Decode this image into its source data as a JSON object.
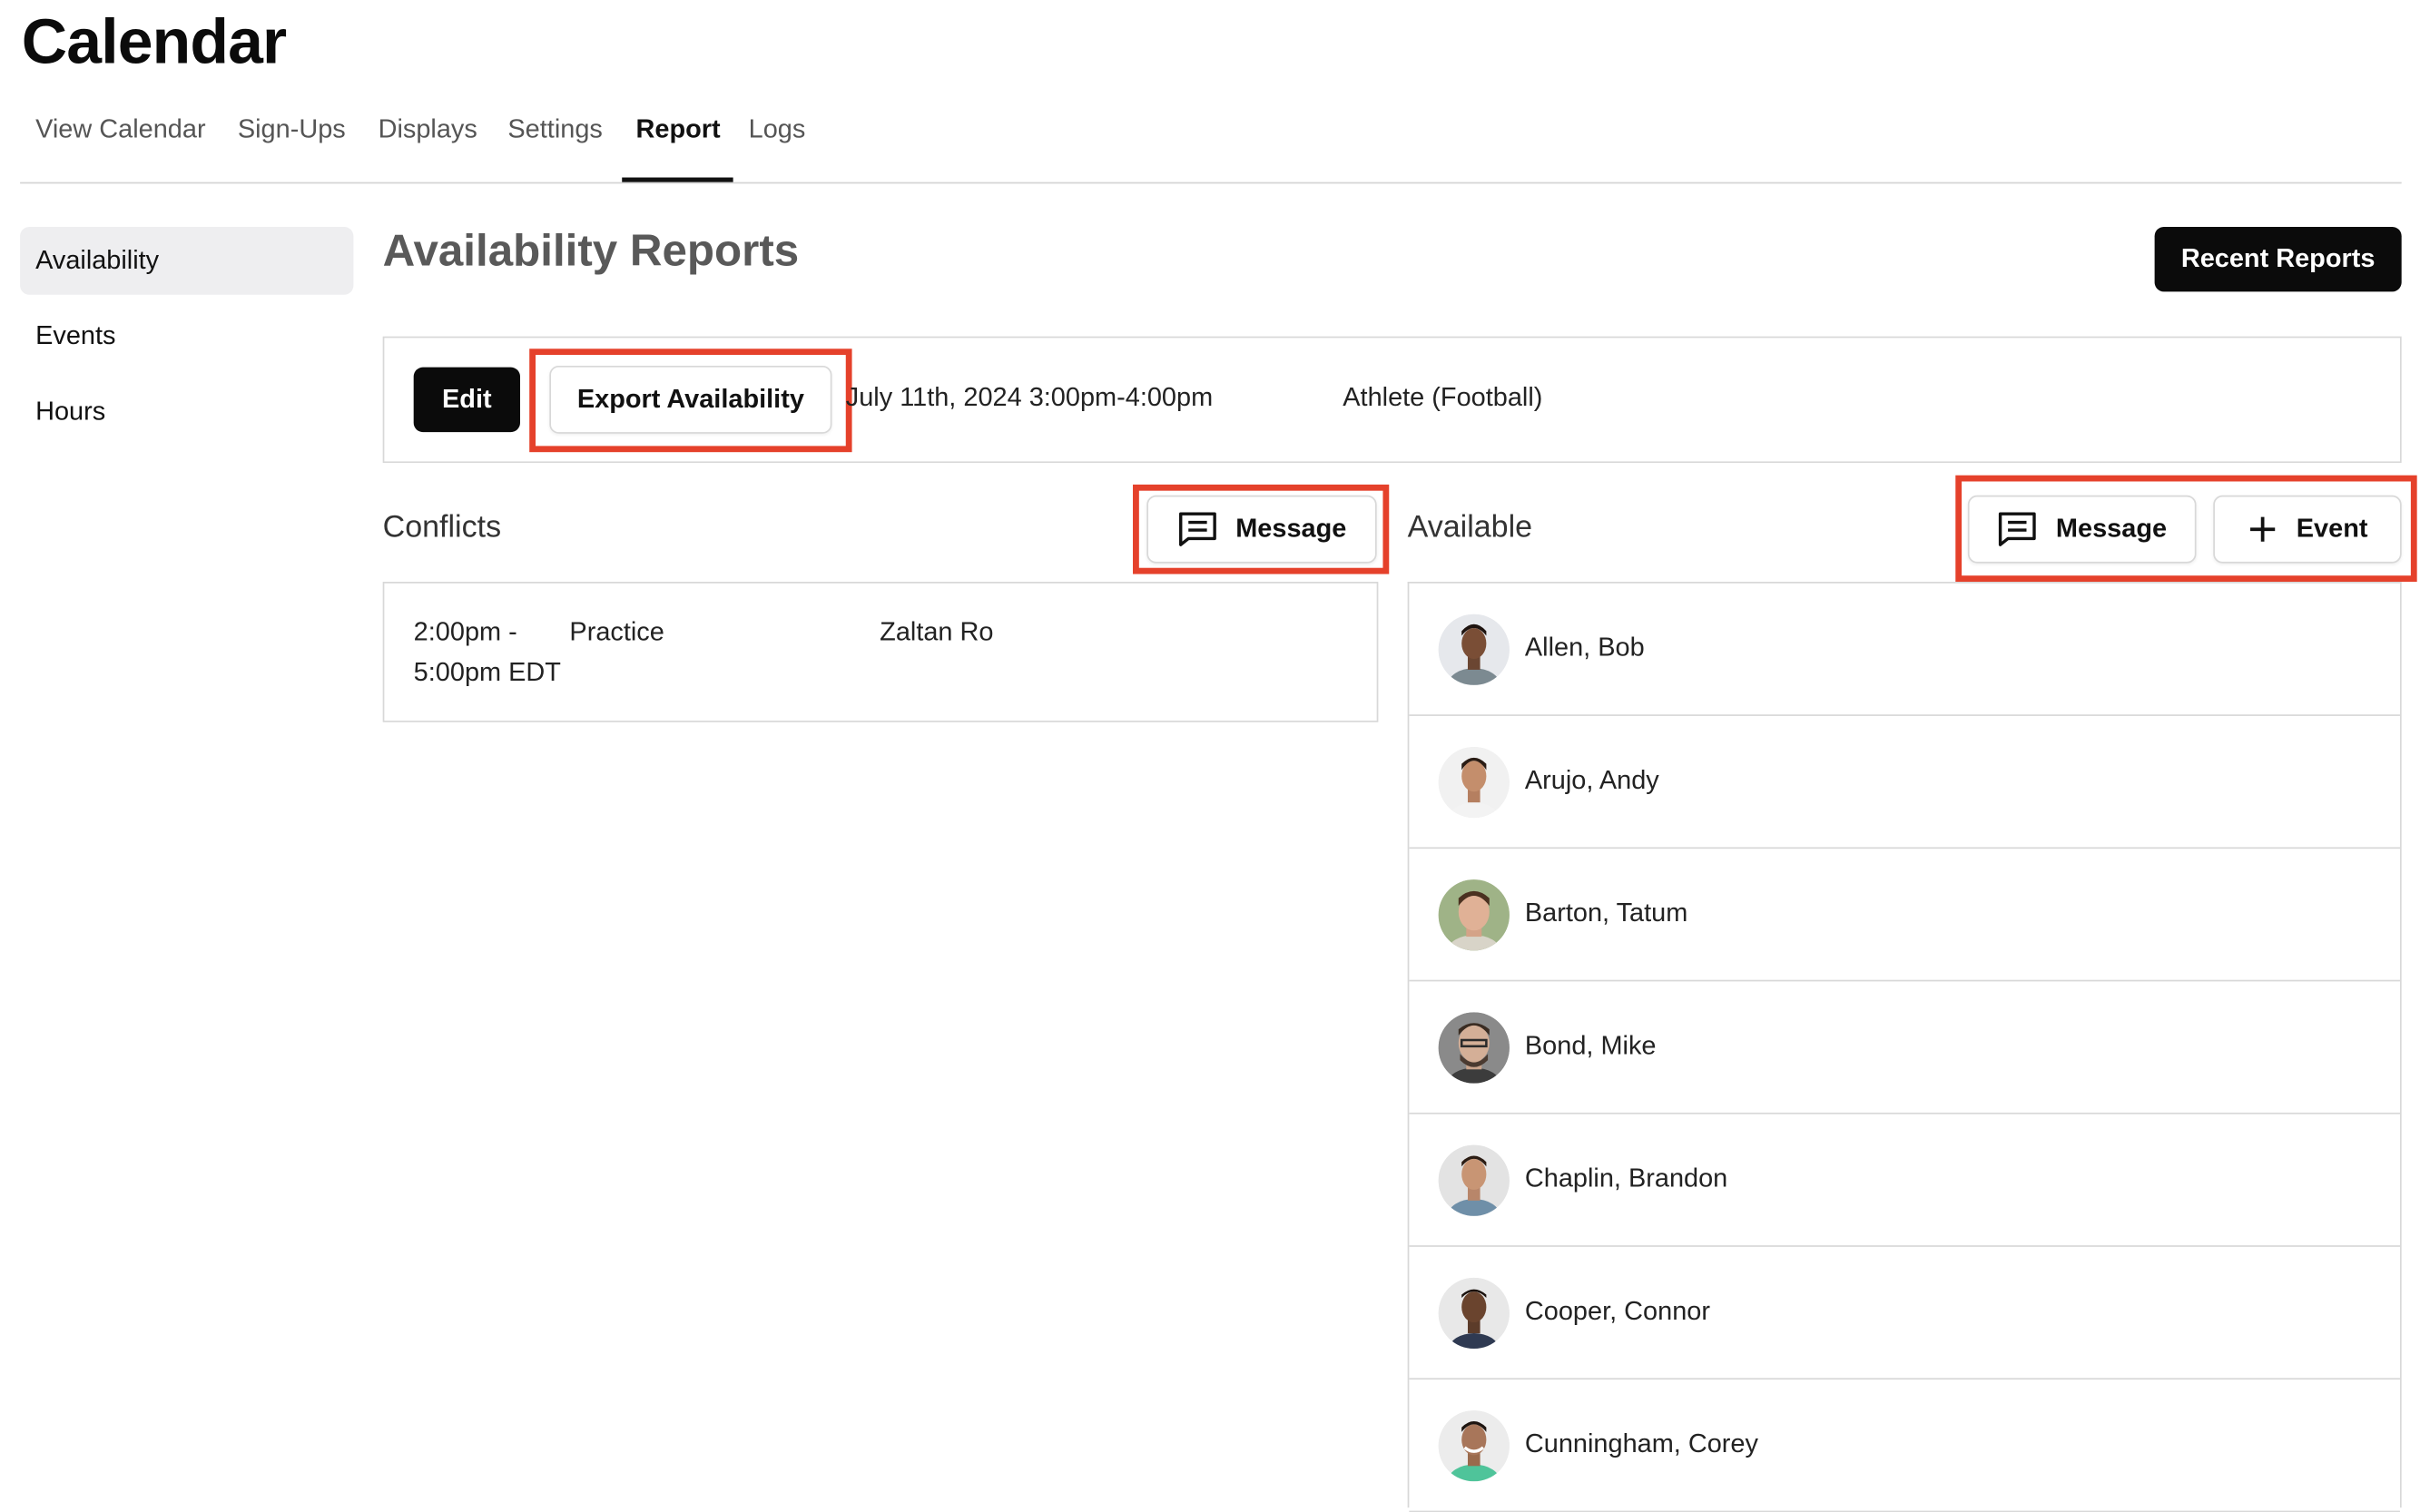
{
  "app": {
    "title": "Calendar"
  },
  "tabs": [
    {
      "label": "View Calendar"
    },
    {
      "label": "Sign-Ups"
    },
    {
      "label": "Displays"
    },
    {
      "label": "Settings"
    },
    {
      "label": "Report",
      "active": true
    },
    {
      "label": "Logs"
    }
  ],
  "sidebar": {
    "items": [
      {
        "label": "Availability",
        "active": true
      },
      {
        "label": "Events"
      },
      {
        "label": "Hours"
      }
    ]
  },
  "main": {
    "heading": "Availability Reports",
    "recent_reports_label": "Recent Reports",
    "info": {
      "edit_label": "Edit",
      "export_label": "Export Availability",
      "date_text": "July 11th, 2024 3:00pm-4:00pm",
      "group_text": "Athlete (Football)"
    },
    "conflicts": {
      "title": "Conflicts",
      "message_label": "Message",
      "items": [
        {
          "time_line1": "2:00pm -",
          "time_line2": "5:00pm EDT",
          "event": "Practice",
          "person": "Zaltan Ro"
        }
      ]
    },
    "available": {
      "title": "Available",
      "message_label": "Message",
      "event_label": "Event",
      "people": [
        {
          "name": "Allen, Bob"
        },
        {
          "name": "Arujo, Andy"
        },
        {
          "name": "Barton, Tatum"
        },
        {
          "name": "Bond, Mike"
        },
        {
          "name": "Chaplin, Brandon"
        },
        {
          "name": "Cooper, Connor"
        },
        {
          "name": "Cunningham, Corey"
        }
      ]
    }
  },
  "colors": {
    "highlight": "#e5412b",
    "primary_button": "#0b0b0b",
    "sidebar_active_bg": "#eeeef0"
  },
  "icons": {
    "message": "message-square-icon",
    "add": "plus-icon",
    "avatar": "avatar-photo"
  }
}
